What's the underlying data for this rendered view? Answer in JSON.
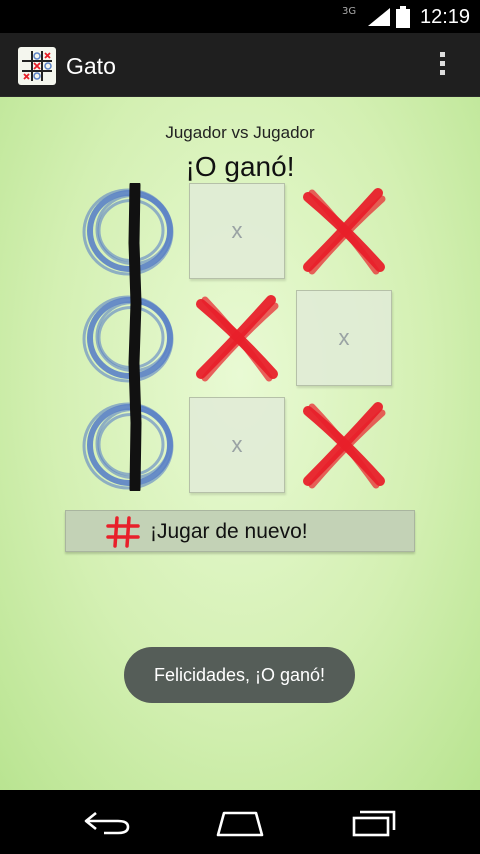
{
  "status_bar": {
    "network": "3G",
    "time": "12:19"
  },
  "app": {
    "title": "Gato",
    "icon": "tic-tac-toe-icon"
  },
  "game": {
    "mode": "Jugador vs Jugador",
    "result": "¡O ganó!",
    "board": [
      [
        "O",
        "",
        "X"
      ],
      [
        "O",
        "X",
        ""
      ],
      [
        "O",
        "",
        "X"
      ]
    ],
    "empty_cell_label": "x",
    "winning_line": "column-1"
  },
  "play_again": {
    "icon": "hash-icon",
    "label": "¡Jugar de nuevo!"
  },
  "toast": {
    "message": "Felicidades, ¡O ganó!"
  },
  "nav": {
    "back": "back-icon",
    "home": "home-icon",
    "recents": "recents-icon"
  },
  "colors": {
    "o": "#5b82c6",
    "x": "#e8202a",
    "line": "#111111"
  }
}
